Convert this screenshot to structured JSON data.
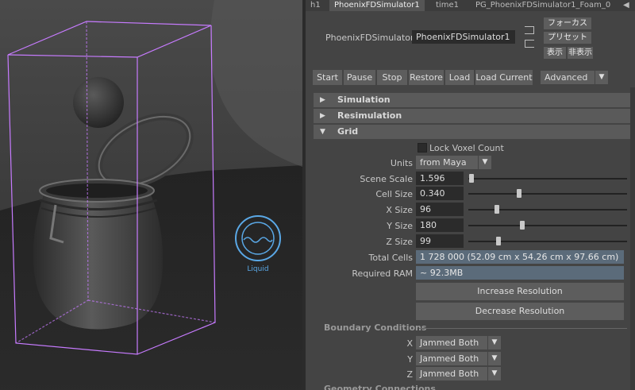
{
  "tabs": [
    "h1",
    "PhoenixFDSimulator1",
    "time1",
    "PG_PhoenixFDSimulator1_Foam_0"
  ],
  "header": {
    "node_label": "PhoenixFDSimulator:",
    "node_value": "PhoenixFDSimulator1",
    "focus_label": "フォーカス",
    "preset_label": "プリセット",
    "show_label": "表示",
    "hide_label": "非表示"
  },
  "toolbar": {
    "start": "Start",
    "pause": "Pause",
    "stop": "Stop",
    "restore": "Restore",
    "load": "Load",
    "load_current": "Load Current",
    "mode": "Advanced"
  },
  "sections": {
    "simulation": "Simulation",
    "resimulation": "Resimulation",
    "grid": "Grid"
  },
  "grid": {
    "lock_voxel": "Lock Voxel Count",
    "units_label": "Units",
    "units_value": "from Maya",
    "scene_scale_label": "Scene Scale",
    "scene_scale_value": "1.596",
    "cell_size_label": "Cell Size",
    "cell_size_value": "0.340",
    "x_size_label": "X Size",
    "x_size_value": "96",
    "y_size_label": "Y Size",
    "y_size_value": "180",
    "z_size_label": "Z Size",
    "z_size_value": "99",
    "total_cells_label": "Total Cells",
    "total_cells_value": "1 728 000 (52.09 cm x 54.26 cm x 97.66 cm)",
    "required_ram_label": "Required RAM",
    "required_ram_value": "~ 92.3MB",
    "increase": "Increase Resolution",
    "decrease": "Decrease Resolution"
  },
  "boundary": {
    "title": "Boundary Conditions",
    "x_label": "X",
    "x_value": "Jammed Both",
    "y_label": "Y",
    "y_value": "Jammed Both",
    "z_label": "Z",
    "z_value": "Jammed Both"
  },
  "geometry": {
    "title": "Geometry Connections"
  },
  "viewport": {
    "liquid_label": "Liquid"
  },
  "colors": {
    "bbox": "#c77bff",
    "liquid_icon": "#5aa8e6"
  }
}
